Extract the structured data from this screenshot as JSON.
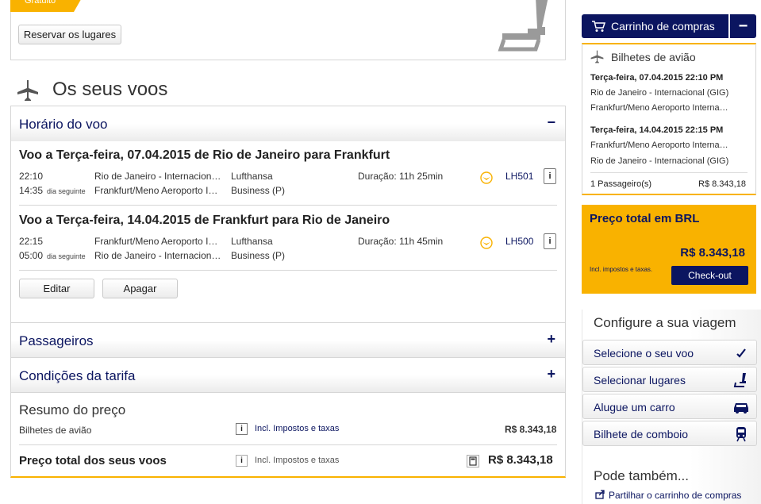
{
  "top": {
    "free_badge": "Gratuito",
    "reserve_seats_button": "Reservar os lugares"
  },
  "flights_section": {
    "title": "Os seus voos"
  },
  "accordion": {
    "schedule_label": "Horário do voo",
    "schedule_toggle": "−",
    "passengers_label": "Passageiros",
    "passengers_toggle": "+",
    "fare_label": "Condições da tarifa",
    "fare_toggle": "+"
  },
  "flights": [
    {
      "title": "Voo a Terça-feira, 07.04.2015 de Rio de Janeiro para Frankfurt",
      "dep_time": "22:10",
      "arr_time": "14:35",
      "arr_note": "dia seguinte",
      "dep_airport": "Rio de Janeiro - Internacion…",
      "arr_airport": "Frankfurt/Meno Aeroporto I…",
      "airline": "Lufthansa",
      "cabin": "Business (P)",
      "duration": "Duração: 11h 25min",
      "number": "LH501"
    },
    {
      "title": "Voo a Terça-feira, 14.04.2015 de Frankfurt para Rio de Janeiro",
      "dep_time": "22:15",
      "arr_time": "05:00",
      "arr_note": "dia seguinte",
      "dep_airport": "Frankfurt/Meno Aeroporto I…",
      "arr_airport": "Rio de Janeiro - Internacion…",
      "airline": "Lufthansa",
      "cabin": "Business (P)",
      "duration": "Duração: 11h 45min",
      "number": "LH500"
    }
  ],
  "actions": {
    "edit": "Editar",
    "delete": "Apagar"
  },
  "price_summary": {
    "title": "Resumo do preço",
    "tickets_label": "Bilhetes de avião",
    "tickets_tax": "Incl. Impostos e taxas",
    "tickets_amount": "R$ 8.343,18",
    "total_label": "Preço total dos seus voos",
    "total_tax": "Incl. Impostos e taxas",
    "total_amount": "R$ 8.343,18"
  },
  "cart": {
    "button_label": "Carrinho de compras",
    "collapse": "−",
    "heading": "Bilhetes de avião",
    "outbound_date": "Terça-feira, 07.04.2015 22:10 PM",
    "outbound_from": "Rio de Janeiro - Internacional (GIG)",
    "outbound_to": "Frankfurt/Meno Aeroporto Interna…",
    "return_date": "Terça-feira, 14.04.2015 22:15 PM",
    "return_from": "Frankfurt/Meno Aeroporto Interna…",
    "return_to": "Rio de Janeiro - Internacional (GIG)",
    "passengers": "1 Passageiro(s)",
    "amount": "R$ 8.343,18"
  },
  "total": {
    "label": "Preço total em BRL",
    "amount": "R$ 8.343,18",
    "tax_note": "Incl. impostos e taxas.",
    "checkout": "Check-out"
  },
  "configure": {
    "title": "Configure a sua viagem",
    "items": [
      {
        "label": "Selecione o seu voo"
      },
      {
        "label": "Selecionar lugares"
      },
      {
        "label": "Alugue um carro"
      },
      {
        "label": "Bilhete de comboio"
      }
    ],
    "more_title": "Pode também...",
    "share_cart": "Partilhar o carrinho de compras"
  },
  "colors": {
    "brand_navy": "#0b1560",
    "brand_yellow": "#f9b200"
  }
}
